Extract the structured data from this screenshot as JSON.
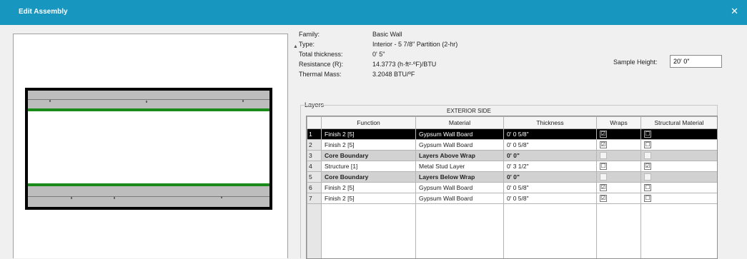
{
  "window": {
    "title": "Edit Assembly",
    "close_glyph": "✕"
  },
  "info": {
    "family_label": "Family:",
    "family_value": "Basic Wall",
    "type_label": "Type:",
    "type_value": "Interior - 5 7/8\" Partition (2-hr)",
    "thickness_label": "Total thickness:",
    "thickness_value": "0' 5\"",
    "resistance_label": "Resistance (R):",
    "resistance_value": "14.3773 (h·ft²·ºF)/BTU",
    "mass_label": "Thermal Mass:",
    "mass_value": "3.2048 BTU/ºF"
  },
  "sample": {
    "label": "Sample Height:",
    "value": "20' 0\""
  },
  "layers": {
    "group_label": "Layers",
    "side_label": "EXTERIOR SIDE",
    "columns": [
      "",
      "Function",
      "Material",
      "Thickness",
      "Wraps",
      "Structural Material"
    ],
    "rows": [
      {
        "num": "1",
        "function": "Finish 2 [5]",
        "material": "Gypsum Wall Board",
        "thickness": "0' 0 5/8\"",
        "wraps": "☑",
        "structural": "☐",
        "kind": "selected"
      },
      {
        "num": "2",
        "function": "Finish 2 [5]",
        "material": "Gypsum Wall Board",
        "thickness": "0' 0 5/8\"",
        "wraps": "☑",
        "structural": "☐",
        "kind": "normal"
      },
      {
        "num": "3",
        "function": "Core Boundary",
        "material": "Layers Above Wrap",
        "thickness": "0' 0\"",
        "wraps": "",
        "structural": "",
        "kind": "core"
      },
      {
        "num": "4",
        "function": "Structure [1]",
        "material": "Metal Stud Layer",
        "thickness": "0' 3 1/2\"",
        "wraps": "☐",
        "structural": "☑",
        "kind": "normal"
      },
      {
        "num": "5",
        "function": "Core Boundary",
        "material": "Layers Below Wrap",
        "thickness": "0' 0\"",
        "wraps": "",
        "structural": "",
        "kind": "core"
      },
      {
        "num": "6",
        "function": "Finish 2 [5]",
        "material": "Gypsum Wall Board",
        "thickness": "0' 0 5/8\"",
        "wraps": "☑",
        "structural": "☐",
        "kind": "normal"
      },
      {
        "num": "7",
        "function": "Finish 2 [5]",
        "material": "Gypsum Wall Board",
        "thickness": "0' 0 5/8\"",
        "wraps": "☑",
        "structural": "☐",
        "kind": "normal"
      }
    ]
  },
  "colors": {
    "titlebar": "#1797c0",
    "core_line": "#1a8a1a",
    "layer_fill": "#bdbdbd",
    "selected_row": "#000000"
  }
}
